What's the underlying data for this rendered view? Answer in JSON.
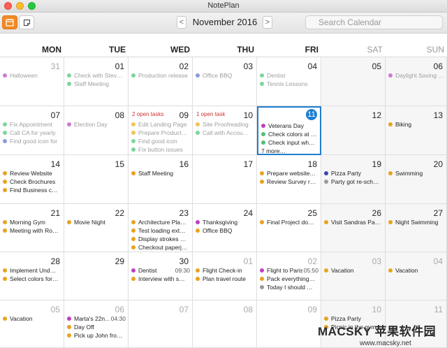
{
  "window": {
    "title": "NotePlan"
  },
  "toolbar": {
    "calendar_icon": "calendar-icon",
    "notes_icon": "note-icon",
    "prev": "<",
    "next": ">",
    "month": "November 2016",
    "search_placeholder": "Search Calendar"
  },
  "days_of_week": [
    "MON",
    "TUE",
    "WED",
    "THU",
    "FRI",
    "SAT",
    "SUN"
  ],
  "colors": {
    "orange": "#e9a21f",
    "green": "#4fbf7a",
    "blue": "#6b7fd6",
    "magenta": "#c03fc0",
    "gray": "#9a9a9a",
    "navy": "#3b46b0",
    "today": "#1e7fd0",
    "open_tasks": "#d03030"
  },
  "weeks": [
    [
      {
        "day": "31",
        "dim": true,
        "events": [
          {
            "text": "Halloween",
            "color": "#d07ad0",
            "faded": true
          }
        ]
      },
      {
        "day": "01",
        "events": [
          {
            "text": "Check with Stev…",
            "color": "#7fd49a",
            "faded": true
          },
          {
            "text": "Staff Meeting",
            "color": "#7fd49a",
            "faded": true
          }
        ]
      },
      {
        "day": "02",
        "events": [
          {
            "text": "Production release",
            "color": "#7fd49a",
            "faded": true
          }
        ]
      },
      {
        "day": "03",
        "events": [
          {
            "text": "Office BBQ",
            "color": "#8c9ae0",
            "faded": true
          }
        ]
      },
      {
        "day": "04",
        "events": [
          {
            "text": "Dentist",
            "color": "#7fd49a",
            "faded": true
          },
          {
            "text": "Tennis Lessons",
            "color": "#7fd49a",
            "faded": true
          }
        ]
      },
      {
        "day": "05",
        "weekend": true,
        "events": []
      },
      {
        "day": "06",
        "weekend": true,
        "events": [
          {
            "text": "Daylight Saving …",
            "color": "#d07ad0",
            "faded": true
          }
        ]
      }
    ],
    [
      {
        "day": "07",
        "events": [
          {
            "text": "Fix Appointment",
            "color": "#7fd49a",
            "faded": true
          },
          {
            "text": "Call CA for yearly",
            "color": "#7fd49a",
            "faded": true
          },
          {
            "text": "Find good icon for",
            "color": "#8c9ae0",
            "faded": true
          }
        ]
      },
      {
        "day": "08",
        "events": [
          {
            "text": "Election Day",
            "color": "#d07ad0",
            "faded": true
          }
        ]
      },
      {
        "day": "09",
        "open_tasks": "2 open tasks",
        "events": [
          {
            "text": "Edit Landing Page",
            "color": "#f0c45a",
            "faded": true
          },
          {
            "text": "Prepare Product…",
            "color": "#f0c45a",
            "faded": true
          },
          {
            "text": "Find good icon",
            "color": "#7fd49a",
            "faded": true
          },
          {
            "text": "Fix button issues",
            "color": "#7fd49a",
            "faded": true
          }
        ]
      },
      {
        "day": "10",
        "open_tasks": "1 open task",
        "events": [
          {
            "text": "Site Proofreading",
            "color": "#f0c45a",
            "faded": true
          },
          {
            "text": "Call with Accou…",
            "color": "#7fd49a",
            "faded": true
          }
        ]
      },
      {
        "day": "11",
        "today": true,
        "events": [
          {
            "text": "Veterans Day",
            "color": "#c03fc0"
          },
          {
            "text": "Check colors at …",
            "color": "#4fbf7a"
          },
          {
            "text": "Check input wh…",
            "color": "#4fbf7a"
          }
        ],
        "more": "7 more…"
      },
      {
        "day": "12",
        "weekend": true,
        "events": []
      },
      {
        "day": "13",
        "weekend": true,
        "events": [
          {
            "text": "Biking",
            "color": "#e9a21f"
          }
        ]
      }
    ],
    [
      {
        "day": "14",
        "events": [
          {
            "text": "Review Website",
            "color": "#e9a21f"
          },
          {
            "text": "Check Brochures",
            "color": "#e9a21f"
          },
          {
            "text": "Find Business c…",
            "color": "#e9a21f"
          }
        ]
      },
      {
        "day": "15",
        "events": []
      },
      {
        "day": "16",
        "events": [
          {
            "text": "Staff Meeting",
            "color": "#e9a21f"
          }
        ]
      },
      {
        "day": "17",
        "events": []
      },
      {
        "day": "18",
        "events": [
          {
            "text": "Prepare website…",
            "color": "#e9a21f"
          },
          {
            "text": "Review Survey r…",
            "color": "#e9a21f"
          }
        ]
      },
      {
        "day": "19",
        "weekend": true,
        "events": [
          {
            "text": "Pizza Party",
            "color": "#3b46b0"
          },
          {
            "text": "Party got re-sch…",
            "color": "#9a9a9a"
          }
        ]
      },
      {
        "day": "20",
        "weekend": true,
        "events": [
          {
            "text": "Swimming",
            "color": "#e9a21f"
          }
        ]
      }
    ],
    [
      {
        "day": "21",
        "events": [
          {
            "text": "Morning Gym",
            "color": "#e9a21f"
          },
          {
            "text": "Meeting with Ro…",
            "color": "#e9a21f"
          }
        ]
      },
      {
        "day": "22",
        "events": [
          {
            "text": "Movie Night",
            "color": "#e9a21f"
          }
        ]
      },
      {
        "day": "23",
        "events": [
          {
            "text": "Architecture Pla…",
            "color": "#e9a21f"
          },
          {
            "text": "Test loading ext…",
            "color": "#e9a21f"
          },
          {
            "text": "Display strokes …",
            "color": "#e9a21f"
          },
          {
            "text": "Checkout paperj…",
            "color": "#e9a21f"
          }
        ]
      },
      {
        "day": "24",
        "events": [
          {
            "text": "Thanksgiving",
            "color": "#c03fc0"
          },
          {
            "text": "Office BBQ",
            "color": "#e9a21f"
          }
        ]
      },
      {
        "day": "25",
        "events": [
          {
            "text": "Final Project do…",
            "color": "#e9a21f"
          }
        ]
      },
      {
        "day": "26",
        "weekend": true,
        "events": [
          {
            "text": "Visit Sandras Pa…",
            "color": "#e9a21f"
          }
        ]
      },
      {
        "day": "27",
        "weekend": true,
        "events": [
          {
            "text": "Night Swimming",
            "color": "#e9a21f"
          }
        ]
      }
    ],
    [
      {
        "day": "28",
        "events": [
          {
            "text": "Implement Und…",
            "color": "#e9a21f"
          },
          {
            "text": "Select colors for…",
            "color": "#e9a21f"
          }
        ]
      },
      {
        "day": "29",
        "events": []
      },
      {
        "day": "30",
        "events": [
          {
            "text": "Dentist",
            "color": "#c03fc0",
            "time": "09:30"
          },
          {
            "text": "Interview with s…",
            "color": "#e9a21f"
          }
        ]
      },
      {
        "day": "01",
        "dim": true,
        "events": [
          {
            "text": "Flight Check-in",
            "color": "#e9a21f"
          },
          {
            "text": "Plan travel route",
            "color": "#e9a21f"
          }
        ]
      },
      {
        "day": "02",
        "dim": true,
        "events": [
          {
            "text": "Flight to Paris",
            "color": "#c03fc0",
            "time": "05:50"
          },
          {
            "text": "Pack everything…",
            "color": "#e9a21f"
          },
          {
            "text": "Today I should …",
            "color": "#9a9a9a"
          }
        ]
      },
      {
        "day": "03",
        "dim": true,
        "weekend": true,
        "events": [
          {
            "text": "Vacation",
            "color": "#e9a21f"
          }
        ]
      },
      {
        "day": "04",
        "dim": true,
        "weekend": true,
        "events": [
          {
            "text": "Vacation",
            "color": "#e9a21f"
          }
        ]
      }
    ],
    [
      {
        "day": "05",
        "dim": true,
        "events": [
          {
            "text": "Vacation",
            "color": "#e9a21f"
          }
        ]
      },
      {
        "day": "06",
        "dim": true,
        "events": [
          {
            "text": "Marta's 22n…",
            "color": "#c03fc0",
            "time": "04:30"
          },
          {
            "text": "Day Off",
            "color": "#e9a21f"
          },
          {
            "text": "Pick up John fro…",
            "color": "#e9a21f"
          }
        ]
      },
      {
        "day": "07",
        "dim": true,
        "events": []
      },
      {
        "day": "08",
        "dim": true,
        "events": []
      },
      {
        "day": "09",
        "dim": true,
        "events": []
      },
      {
        "day": "10",
        "dim": true,
        "weekend": true,
        "events": [
          {
            "text": "Pizza Party",
            "color": "#e9a21f"
          },
          {
            "text": "Picnic in the gym",
            "color": "#e9a21f"
          }
        ]
      },
      {
        "day": "11",
        "dim": true,
        "weekend": true,
        "events": []
      }
    ]
  ],
  "watermark": {
    "brand": "MACSKY 苹果软件园",
    "url": "www.macsky.net"
  }
}
